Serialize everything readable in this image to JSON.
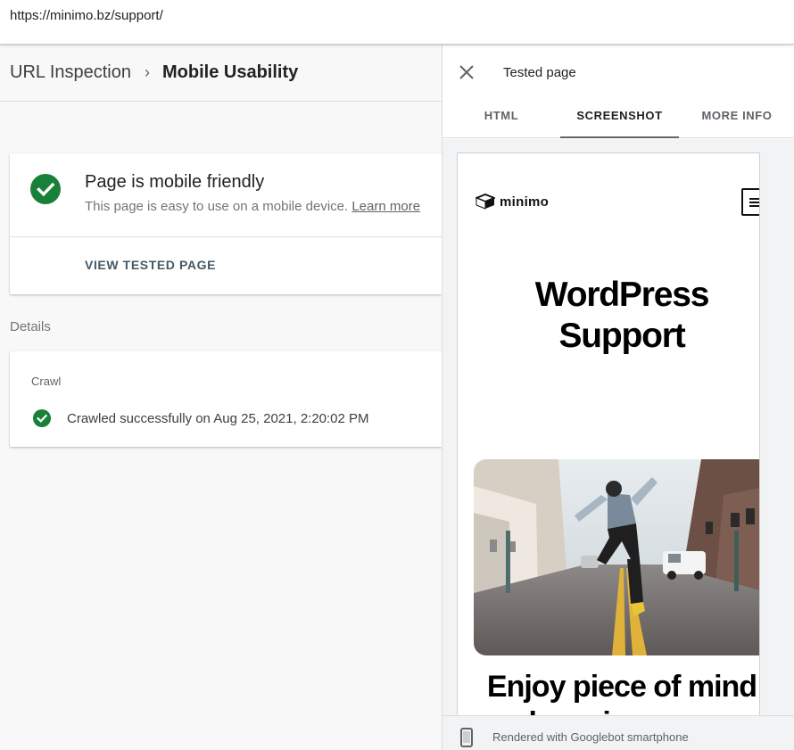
{
  "address_bar": {
    "url": "https://minimo.bz/support/"
  },
  "breadcrumb": {
    "parent": "URL Inspection",
    "separator": "›",
    "current": "Mobile Usability"
  },
  "summary": {
    "title": "Page is mobile friendly",
    "description": "This page is easy to use on a mobile device.",
    "learn_more": "Learn more",
    "view_button": "VIEW TESTED PAGE"
  },
  "details": {
    "label": "Details",
    "crawl_label": "Crawl",
    "crawl_status": "Crawled successfully on Aug 25, 2021, 2:20:02 PM"
  },
  "panel": {
    "title": "Tested page",
    "tabs": [
      {
        "label": "HTML",
        "active": false
      },
      {
        "label": "SCREENSHOT",
        "active": true
      },
      {
        "label": "MORE INFO",
        "active": false
      }
    ],
    "footer": "Rendered with Googlebot smartphone"
  },
  "preview": {
    "logo_text": "minimo",
    "heading_line1": "WordPress",
    "heading_line2": "Support",
    "subheading_line1": "Enjoy piece of mind",
    "subheading_line2": "knowing your"
  },
  "colors": {
    "success": "#188038",
    "tab_indicator": "#5f6368",
    "button_text": "#455a64"
  },
  "icons": {
    "status": "check-circle-icon",
    "close": "close-icon",
    "menu": "hamburger-icon",
    "device": "smartphone-icon"
  }
}
